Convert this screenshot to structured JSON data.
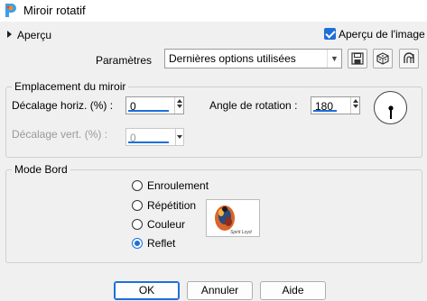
{
  "window": {
    "title": "Miroir rotatif",
    "app_icon": "paintshop-icon"
  },
  "header": {
    "apercu_label": "Aperçu",
    "apercu_image_label": "Aperçu de l'image",
    "apercu_image_checked": true
  },
  "params": {
    "label": "Paramètres",
    "preset_value": "Dernières options utilisées",
    "tools": [
      "save-icon",
      "random-dice-icon",
      "reset-icon"
    ]
  },
  "mirror": {
    "title": "Emplacement du miroir",
    "decalage_horiz_label": "Décalage horiz. (%) :",
    "decalage_horiz_value": "0",
    "angle_label": "Angle de rotation :",
    "angle_value": "180",
    "decalage_vert_label": "Décalage vert. (%) :",
    "decalage_vert_value": "0",
    "dial_angle_deg": 180
  },
  "edge": {
    "title": "Mode Bord",
    "options": [
      {
        "label": "Enroulement",
        "selected": false
      },
      {
        "label": "Répétition",
        "selected": false
      },
      {
        "label": "Couleur",
        "selected": false
      },
      {
        "label": "Reflet",
        "selected": true
      }
    ],
    "thumb_signature": "Spirit Loyd"
  },
  "footer": {
    "ok_label": "OK",
    "cancel_label": "Annuler",
    "help_label": "Aide"
  },
  "colors": {
    "accent": "#1e6fd9",
    "background": "#f0f0f0"
  }
}
